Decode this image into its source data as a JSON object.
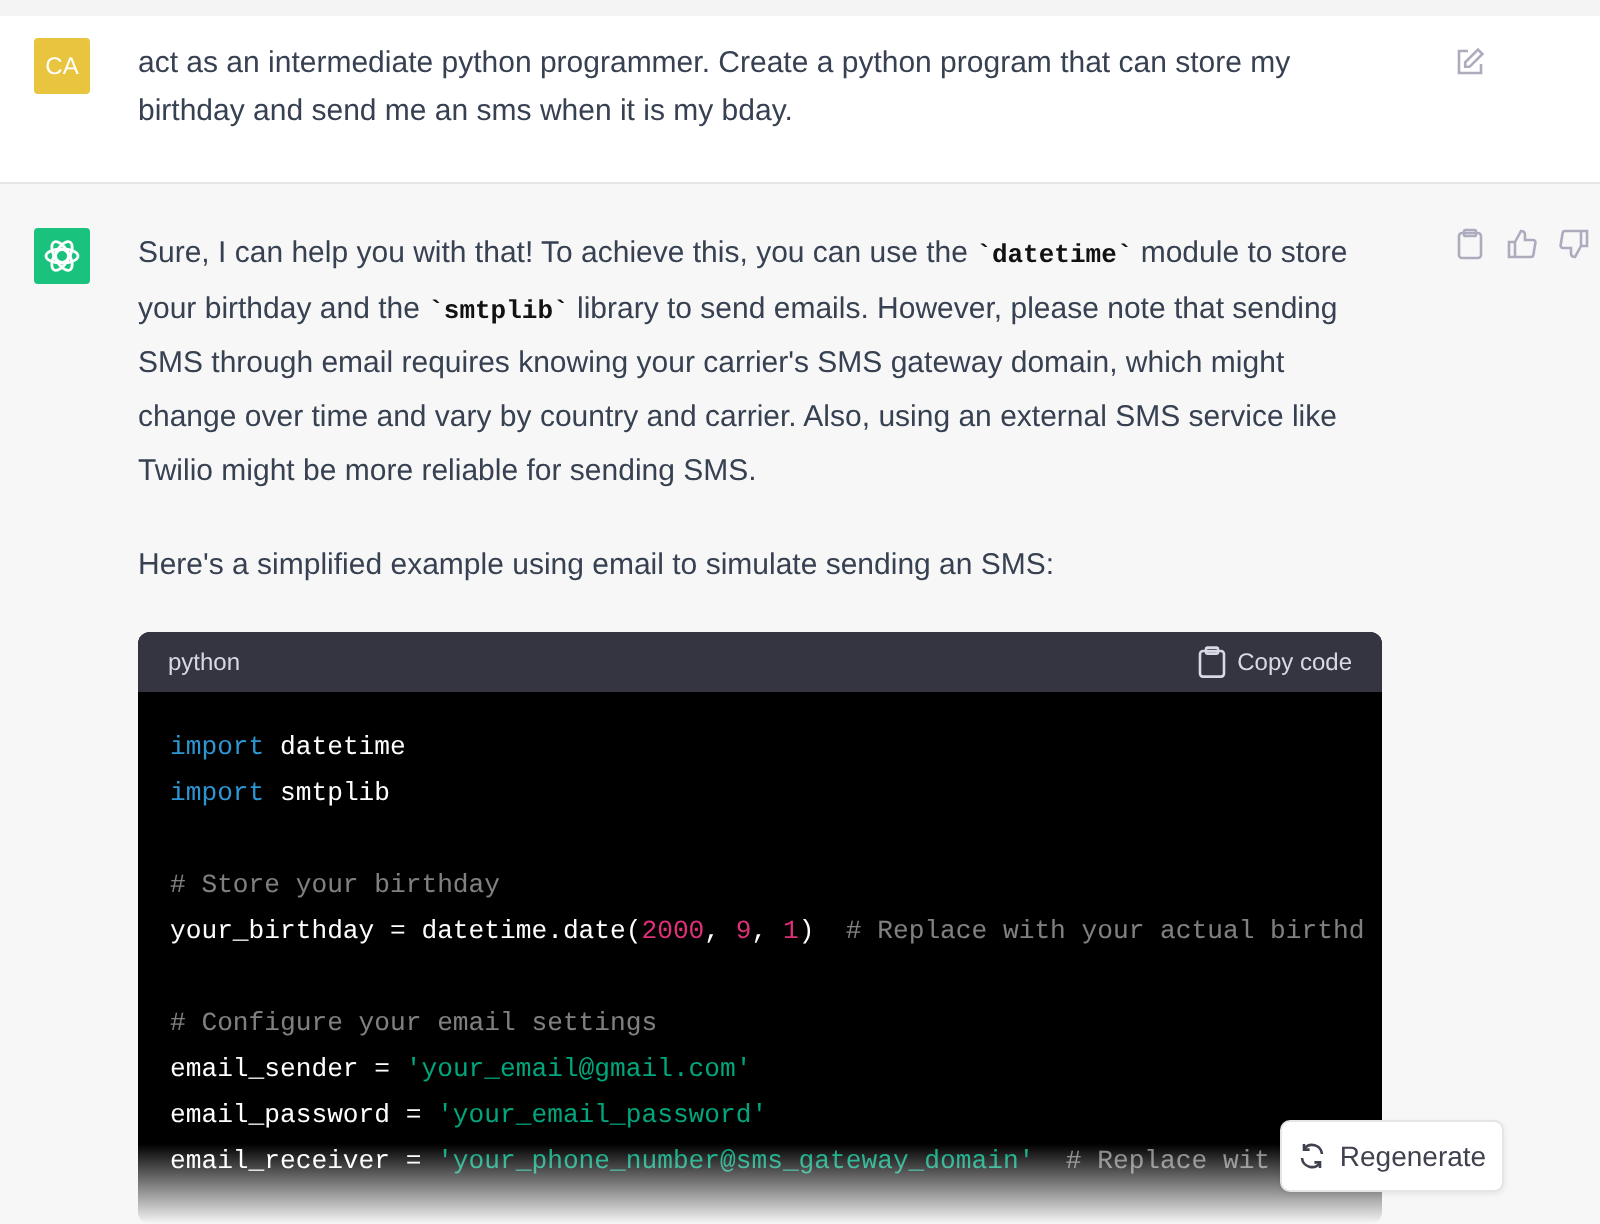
{
  "user_message": {
    "avatar": "CA",
    "text": "act as an intermediate python programmer. Create a python program that can store my birthday and send me an sms when it is my bday."
  },
  "assistant_message": {
    "paragraphs": [
      [
        {
          "kind": "text",
          "text": "Sure, I can help you with that! To achieve this, you can use the "
        },
        {
          "kind": "code",
          "text": "`datetime`"
        },
        {
          "kind": "text",
          "text": " module to store your birthday and the "
        },
        {
          "kind": "code",
          "text": "`smtplib`"
        },
        {
          "kind": "text",
          "text": " library to send emails. However, please note that sending SMS through email requires knowing your carrier's SMS gateway domain, which might change over time and vary by country and carrier. Also, using an external SMS service like Twilio might be more reliable for sending SMS."
        }
      ],
      [
        {
          "kind": "text",
          "text": "Here's a simplified example using email to simulate sending an SMS:"
        }
      ]
    ],
    "code_block": {
      "language": "python",
      "copy_label": "Copy code",
      "lines": [
        {
          "kind": "code",
          "tokens": [
            {
              "kind": "keyword",
              "text": "import"
            },
            {
              "kind": "plain",
              "text": " datetime"
            }
          ]
        },
        {
          "kind": "code",
          "tokens": [
            {
              "kind": "keyword",
              "text": "import"
            },
            {
              "kind": "plain",
              "text": " smtplib"
            }
          ]
        },
        {
          "kind": "blank"
        },
        {
          "kind": "code",
          "tokens": [
            {
              "kind": "comment",
              "text": "# Store your birthday"
            }
          ]
        },
        {
          "kind": "code",
          "tokens": [
            {
              "kind": "plain",
              "text": "your_birthday = datetime.date("
            },
            {
              "kind": "number",
              "text": "2000"
            },
            {
              "kind": "plain",
              "text": ", "
            },
            {
              "kind": "number",
              "text": "9"
            },
            {
              "kind": "plain",
              "text": ", "
            },
            {
              "kind": "number",
              "text": "1"
            },
            {
              "kind": "plain",
              "text": ")  "
            },
            {
              "kind": "comment",
              "text": "# Replace with your actual birthd"
            }
          ]
        },
        {
          "kind": "blank"
        },
        {
          "kind": "code",
          "tokens": [
            {
              "kind": "comment",
              "text": "# Configure your email settings"
            }
          ]
        },
        {
          "kind": "code",
          "tokens": [
            {
              "kind": "plain",
              "text": "email_sender = "
            },
            {
              "kind": "string",
              "text": "'your_email@gmail.com'"
            }
          ]
        },
        {
          "kind": "code",
          "tokens": [
            {
              "kind": "plain",
              "text": "email_password = "
            },
            {
              "kind": "string",
              "text": "'your_email_password'"
            }
          ]
        },
        {
          "kind": "code",
          "tokens": [
            {
              "kind": "plain",
              "text": "email_receiver = "
            },
            {
              "kind": "string",
              "text": "'your_phone_number@sms_gateway_domain'"
            },
            {
              "kind": "comment",
              "text": "  # Replace wit"
            }
          ]
        }
      ]
    }
  },
  "regenerate_button": {
    "label": "Regenerate"
  }
}
